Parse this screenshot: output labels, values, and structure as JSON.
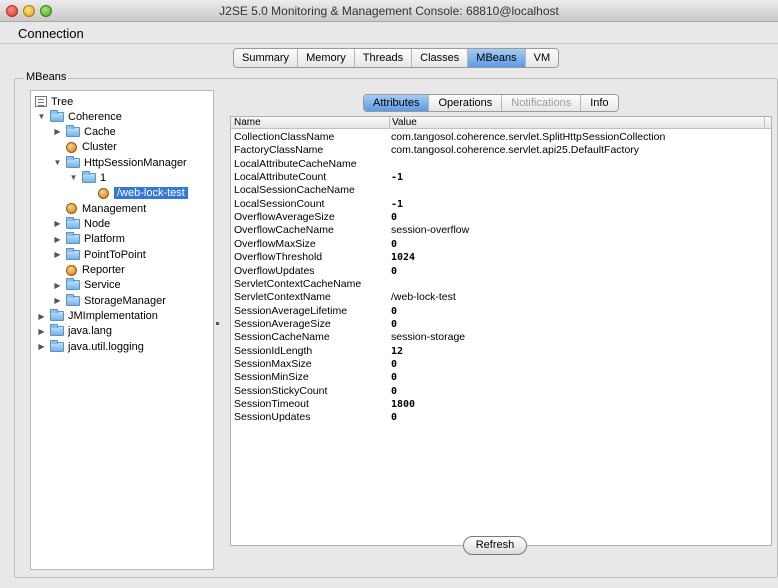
{
  "window": {
    "title": "J2SE 5.0 Monitoring & Management Console: 68810@localhost"
  },
  "menubar": {
    "items": [
      "Connection"
    ]
  },
  "main_tabs": [
    {
      "label": "Summary"
    },
    {
      "label": "Memory"
    },
    {
      "label": "Threads"
    },
    {
      "label": "Classes"
    },
    {
      "label": "MBeans",
      "active": true
    },
    {
      "label": "VM"
    }
  ],
  "mbeans": {
    "group_label": "MBeans"
  },
  "tree": {
    "root": "Tree",
    "nodes": [
      {
        "label": "Coherence",
        "depth": 0,
        "toggle": "open",
        "icon": "folder"
      },
      {
        "label": "Cache",
        "depth": 1,
        "toggle": "closed",
        "icon": "folder"
      },
      {
        "label": "Cluster",
        "depth": 1,
        "toggle": "none",
        "icon": "bean"
      },
      {
        "label": "HttpSessionManager",
        "depth": 1,
        "toggle": "open",
        "icon": "folder"
      },
      {
        "label": "1",
        "depth": 2,
        "toggle": "open",
        "icon": "folder"
      },
      {
        "label": "/web-lock-test",
        "depth": 3,
        "toggle": "none",
        "icon": "bean",
        "selected": true
      },
      {
        "label": "Management",
        "depth": 1,
        "toggle": "none",
        "icon": "bean"
      },
      {
        "label": "Node",
        "depth": 1,
        "toggle": "closed",
        "icon": "folder"
      },
      {
        "label": "Platform",
        "depth": 1,
        "toggle": "closed",
        "icon": "folder"
      },
      {
        "label": "PointToPoint",
        "depth": 1,
        "toggle": "closed",
        "icon": "folder"
      },
      {
        "label": "Reporter",
        "depth": 1,
        "toggle": "none",
        "icon": "bean"
      },
      {
        "label": "Service",
        "depth": 1,
        "toggle": "closed",
        "icon": "folder"
      },
      {
        "label": "StorageManager",
        "depth": 1,
        "toggle": "closed",
        "icon": "folder"
      },
      {
        "label": "JMImplementation",
        "depth": 0,
        "toggle": "closed",
        "icon": "folder"
      },
      {
        "label": "java.lang",
        "depth": 0,
        "toggle": "closed",
        "icon": "folder"
      },
      {
        "label": "java.util.logging",
        "depth": 0,
        "toggle": "closed",
        "icon": "folder"
      }
    ]
  },
  "sub_tabs": [
    {
      "label": "Attributes",
      "active": true
    },
    {
      "label": "Operations"
    },
    {
      "label": "Notifications",
      "disabled": true
    },
    {
      "label": "Info"
    }
  ],
  "attributes": {
    "columns": [
      "Name",
      "Value"
    ],
    "rows": [
      {
        "name": "CollectionClassName",
        "value": "com.tangosol.coherence.servlet.SplitHttpSessionCollection"
      },
      {
        "name": "FactoryClassName",
        "value": "com.tangosol.coherence.servlet.api25.DefaultFactory"
      },
      {
        "name": "LocalAttributeCacheName",
        "value": ""
      },
      {
        "name": "LocalAttributeCount",
        "value": "-1",
        "numeric": true
      },
      {
        "name": "LocalSessionCacheName",
        "value": ""
      },
      {
        "name": "LocalSessionCount",
        "value": "-1",
        "numeric": true
      },
      {
        "name": "OverflowAverageSize",
        "value": "0",
        "numeric": true
      },
      {
        "name": "OverflowCacheName",
        "value": "session-overflow"
      },
      {
        "name": "OverflowMaxSize",
        "value": "0",
        "numeric": true
      },
      {
        "name": "OverflowThreshold",
        "value": "1024",
        "numeric": true
      },
      {
        "name": "OverflowUpdates",
        "value": "0",
        "numeric": true
      },
      {
        "name": "ServletContextCacheName",
        "value": ""
      },
      {
        "name": "ServletContextName",
        "value": "/web-lock-test"
      },
      {
        "name": "SessionAverageLifetime",
        "value": "0",
        "numeric": true
      },
      {
        "name": "SessionAverageSize",
        "value": "0",
        "numeric": true
      },
      {
        "name": "SessionCacheName",
        "value": "session-storage"
      },
      {
        "name": "SessionIdLength",
        "value": "12",
        "numeric": true
      },
      {
        "name": "SessionMaxSize",
        "value": "0",
        "numeric": true
      },
      {
        "name": "SessionMinSize",
        "value": "0",
        "numeric": true
      },
      {
        "name": "SessionStickyCount",
        "value": "0",
        "numeric": true
      },
      {
        "name": "SessionTimeout",
        "value": "1800",
        "numeric": true
      },
      {
        "name": "SessionUpdates",
        "value": "0",
        "numeric": true
      }
    ]
  },
  "buttons": {
    "refresh": "Refresh"
  }
}
